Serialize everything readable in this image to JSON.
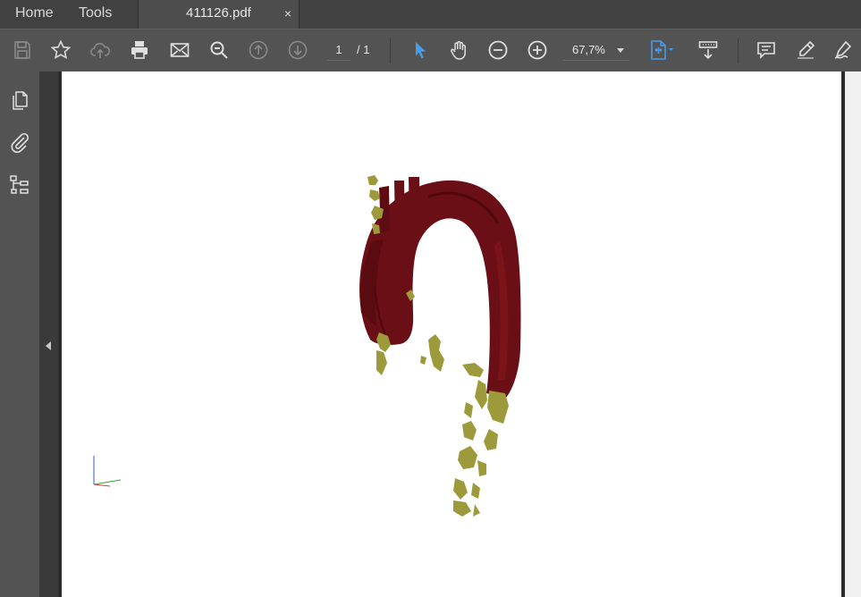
{
  "tabs": {
    "home": "Home",
    "tools": "Tools",
    "document": "411126.pdf",
    "close_symbol": "×"
  },
  "toolbar": {
    "icons": [
      "save-icon",
      "bookmark-star-icon",
      "cloud-upload-icon",
      "print-icon",
      "email-icon",
      "search-zoom-icon",
      "previous-page-icon",
      "next-page-icon",
      "select-cursor-icon",
      "hand-tool-icon",
      "zoom-out-icon",
      "zoom-in-icon",
      "fit-page-icon",
      "scroll-mode-icon",
      "comment-icon",
      "highlight-icon",
      "sign-icon"
    ],
    "page_current": "1",
    "page_total": "/ 1",
    "zoom": "67,7%"
  },
  "left_panel": {
    "icons": [
      "page-thumbnails-icon",
      "attachments-icon",
      "layers-icon"
    ]
  },
  "colors": {
    "accent_blue": "#4a9be8",
    "vessel_red": "#6a0f15",
    "calcification_olive": "#9c9a3b"
  }
}
